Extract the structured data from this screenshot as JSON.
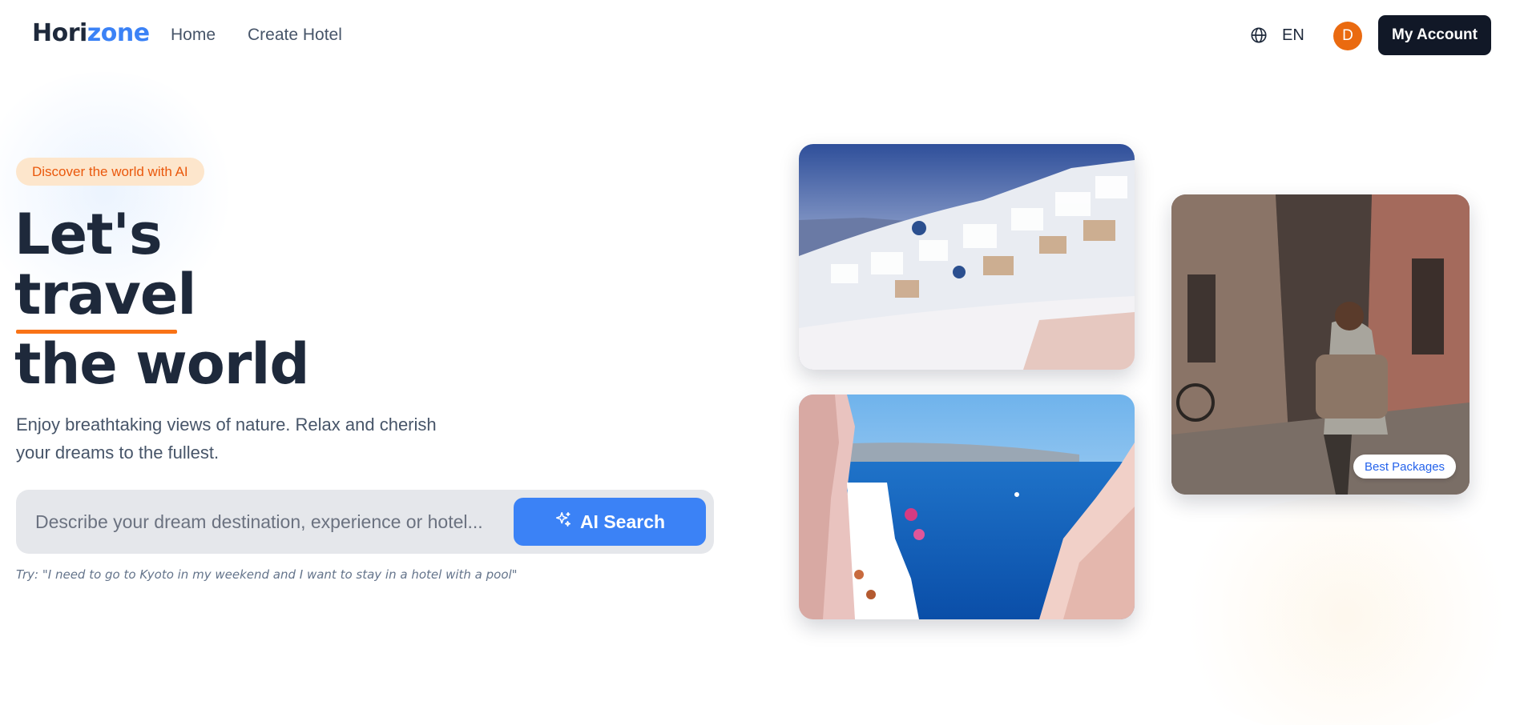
{
  "header": {
    "logo_part1": "Hori",
    "logo_part2": "zone",
    "nav": [
      {
        "label": "Home"
      },
      {
        "label": "Create Hotel"
      }
    ],
    "language": "EN",
    "language_icon": "globe-icon",
    "avatar_initial": "D",
    "account_button": "My Account"
  },
  "hero": {
    "pill": "Discover the world with AI",
    "headline": [
      "Let's",
      "travel",
      "the world"
    ],
    "description_line1": "Enjoy breathtaking views of nature. Relax and cherish",
    "description_line2": "your dreams to the fullest.",
    "search": {
      "placeholder": "Describe your dream destination, experience or hotel...",
      "value": "",
      "button": "AI Search",
      "button_icon": "sparkle-icon"
    },
    "hint": "Try: \"I need to go to Kyoto in my weekend and I want to stay in a hotel with a pool\""
  },
  "gallery": {
    "badge": "Best Packages"
  },
  "colors": {
    "accent": "#3b82f6",
    "orange": "#f97316",
    "dark": "#111827",
    "text": "#1e293b",
    "avatar": "#ea6a10",
    "pill_bg": "#fde6cc"
  }
}
